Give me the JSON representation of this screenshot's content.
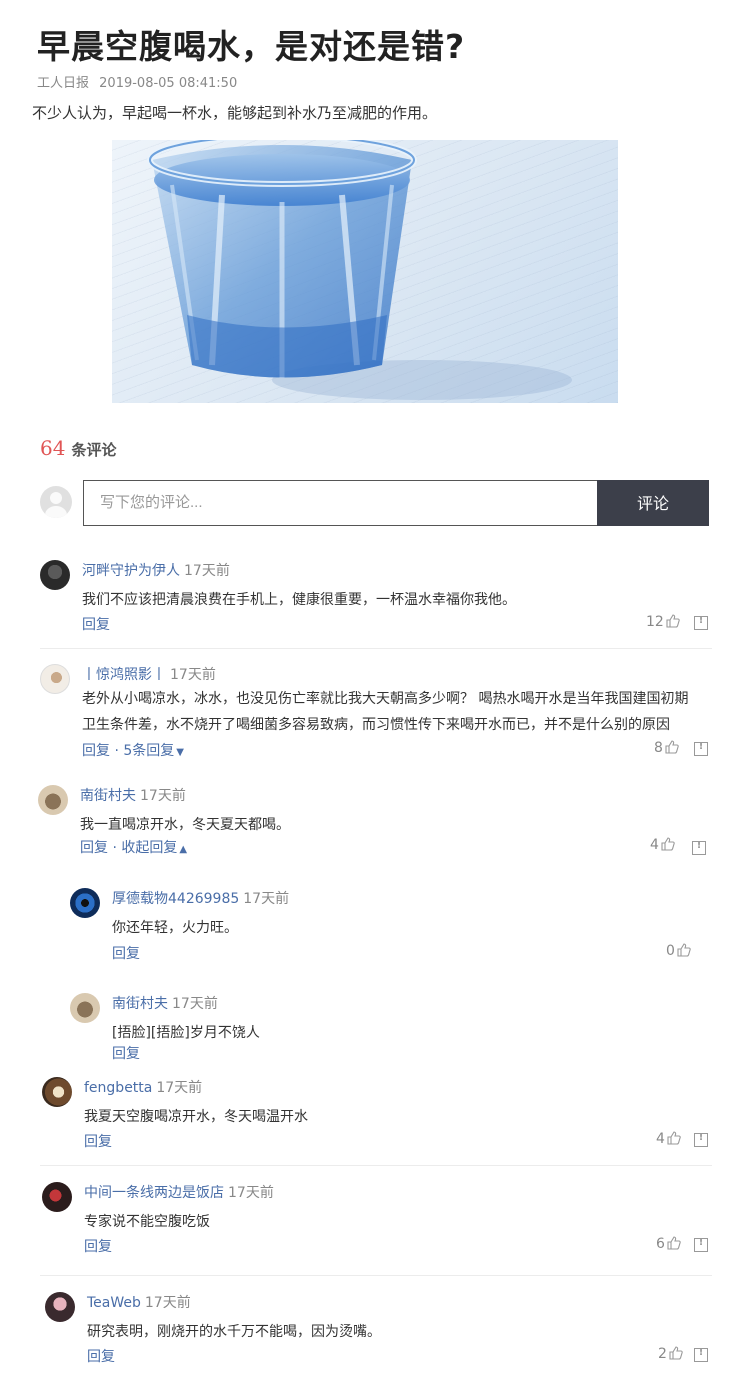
{
  "article": {
    "title": "早晨空腹喝水，是对还是错?",
    "source": "工人日报",
    "date": "2019-08-05 08:41:50",
    "lead": "不少人认为，早起喝一杯水，能够起到补水乃至减肥的作用。",
    "image_icon": "water-glass-image"
  },
  "comments_header": {
    "count": "64",
    "label": "条评论"
  },
  "composer": {
    "placeholder": "写下您的评论...",
    "submit_label": "评论"
  },
  "comments": [
    {
      "name": "河畔守护为伊人",
      "time": "17天前",
      "text": "我们不应该把清晨浪费在手机上，健康很重要，一杯温水幸福你我他。",
      "reply": "回复",
      "likes": "12"
    },
    {
      "name": "丨惊鸿照影丨",
      "time": "17天前",
      "text1": "老外从小喝凉水，冰水，也没见伤亡率就比我大天朝高多少啊？ 喝热水喝开水是当年我国建国初期",
      "text2": "卫生条件差，水不烧开了喝细菌多容易致病，而习惯性传下来喝开水而已，并不是什么别的原因",
      "reply": "回复",
      "sep": "·",
      "more": "5条回复",
      "likes": "8"
    },
    {
      "name": "南街村夫",
      "time": "17天前",
      "text": "我一直喝凉开水，冬天夏天都喝。",
      "reply": "回复",
      "sep": "·",
      "collapse": "收起回复",
      "likes": "4"
    },
    {
      "name": "厚德载物44269985",
      "time": "17天前",
      "text": "你还年轻，火力旺。",
      "reply": "回复",
      "likes": "0"
    },
    {
      "name": "南街村夫",
      "time": "17天前",
      "text": "[捂脸][捂脸]岁月不饶人",
      "reply": "回复"
    },
    {
      "name": "fengbetta",
      "time": "17天前",
      "text": "我夏天空腹喝凉开水，冬天喝温开水",
      "reply": "回复",
      "likes": "4"
    },
    {
      "name": "中间一条线两边是饭店",
      "time": "17天前",
      "text": "专家说不能空腹吃饭",
      "reply": "回复",
      "likes": "6"
    },
    {
      "name": "TeaWeb",
      "time": "17天前",
      "text": "研究表明，刚烧开的水千万不能喝，因为烫嘴。",
      "reply": "回复",
      "likes": "2"
    }
  ],
  "colors": {
    "accent_link": "#4a6ea8",
    "count_red": "#e05555",
    "submit_bg": "#3c3f4a"
  }
}
